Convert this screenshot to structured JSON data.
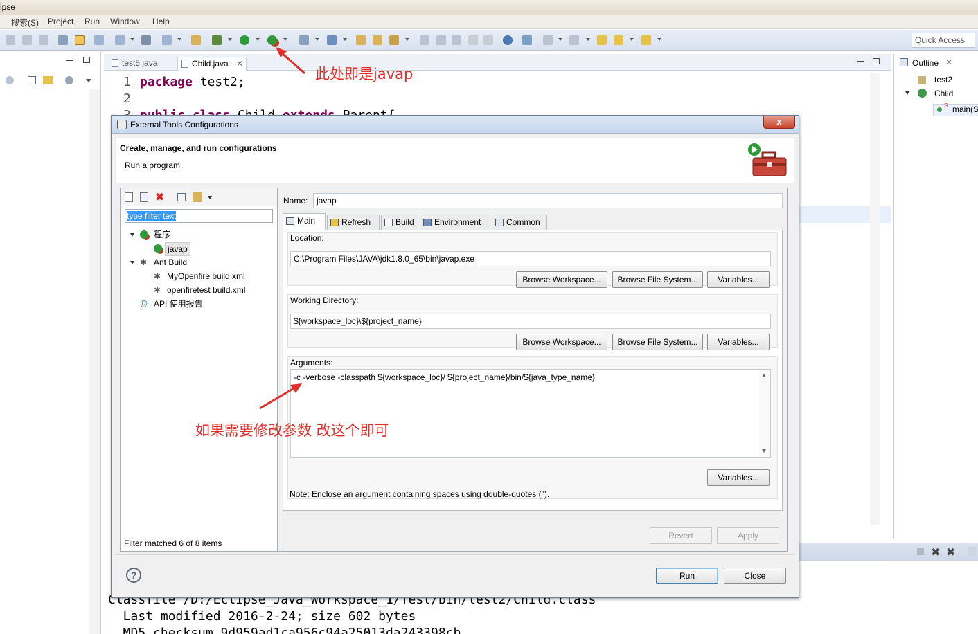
{
  "app": {
    "title_fragment": "ipse",
    "menu": [
      "搜索(S)",
      "Project",
      "Run",
      "Window",
      "Help"
    ],
    "quick_access_placeholder": "Quick Access"
  },
  "editor": {
    "tabs": [
      "test5.java",
      "Child.java"
    ],
    "active_tab": "Child.java",
    "lines": [
      {
        "num": "1",
        "text": "package test2;"
      },
      {
        "num": "2",
        "text": ""
      },
      {
        "num": "3",
        "text": "public class Child extends Parent{"
      }
    ]
  },
  "outline": {
    "title": "Outline",
    "items": [
      "test2",
      "Child",
      "main(S"
    ],
    "static_marker": "S"
  },
  "console": {
    "lines": [
      "Classfile /D:/Eclipse_Java_Workspace_1/Test/bin/test2/Child.class",
      "  Last modified 2016-2-24; size 602 bytes",
      "  MD5 checksum 9d959ad1ca956c94a25013da243398cb"
    ]
  },
  "annotations": {
    "toolbar_note": "此处即是javap",
    "args_note": "如果需要修改参数 改这个即可"
  },
  "dialog": {
    "title": "External Tools Configurations",
    "close_glyph": "x",
    "header_title": "Create, manage, and run configurations",
    "header_subtitle": "Run a program",
    "filter_text": "type filter text",
    "tree": [
      {
        "label": "程序",
        "level": 0,
        "expanded": true
      },
      {
        "label": "javap",
        "level": 1,
        "selected": true
      },
      {
        "label": "Ant Build",
        "level": 0,
        "expanded": true
      },
      {
        "label": "MyOpenfire build.xml",
        "level": 1
      },
      {
        "label": "openfiretest build.xml",
        "level": 1
      },
      {
        "label": "API 使用报告",
        "level": 0
      }
    ],
    "filter_status": "Filter matched 6 of 8 items",
    "name_label": "Name:",
    "name_value": "javap",
    "tabs": [
      "Main",
      "Refresh",
      "Build",
      "Environment",
      "Common"
    ],
    "active_tab": "Main",
    "location_label": "Location:",
    "location_value": "C:\\Program Files\\JAVA\\jdk1.8.0_65\\bin\\javap.exe",
    "working_dir_label": "Working Directory:",
    "working_dir_value": "${workspace_loc}\\${project_name}",
    "browse_workspace": "Browse Workspace...",
    "browse_file_system": "Browse File System...",
    "variables": "Variables...",
    "arguments_label": "Arguments:",
    "arguments_value": "-c -verbose -classpath  ${workspace_loc}/ ${project_name}/bin/${java_type_name}",
    "note": "Note: Enclose an argument containing spaces using double-quotes (\").",
    "revert": "Revert",
    "apply": "Apply",
    "run": "Run",
    "close": "Close",
    "help_glyph": "?"
  },
  "colors": {
    "annotation": "#e0302a",
    "keyword": "#7f0055",
    "selection": "#3399ff"
  }
}
